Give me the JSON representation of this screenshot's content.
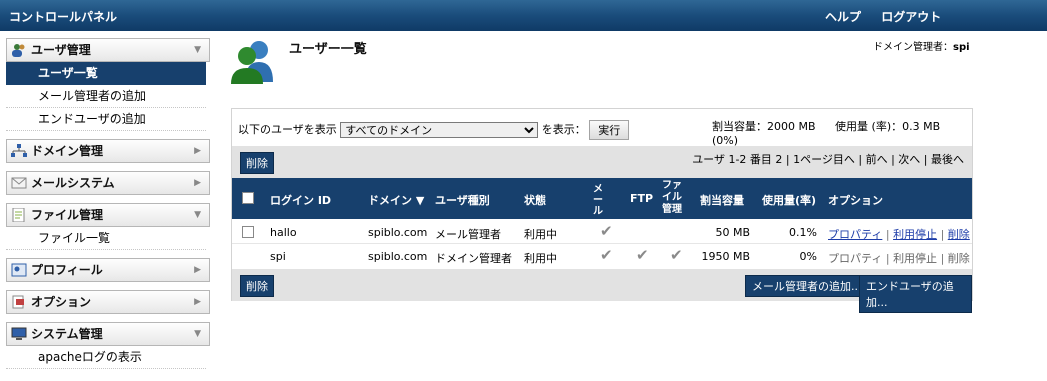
{
  "topbar": {
    "title": "コントロールパネル",
    "help": "ヘルプ",
    "logout": "ログアウト"
  },
  "sidebar": {
    "sections": [
      {
        "label": "ユーザ管理",
        "icon": "users-icon",
        "items": [
          "ユーザ一覧",
          "メール管理者の追加",
          "エンドユーザの追加"
        ]
      },
      {
        "label": "ドメイン管理",
        "icon": "network-icon",
        "items": []
      },
      {
        "label": "メールシステム",
        "icon": "envelope-icon",
        "items": []
      },
      {
        "label": "ファイル管理",
        "icon": "document-icon",
        "items": [
          "ファイル一覧"
        ]
      },
      {
        "label": "プロフィール",
        "icon": "profile-icon",
        "items": []
      },
      {
        "label": "オプション",
        "icon": "options-icon",
        "items": []
      },
      {
        "label": "システム管理",
        "icon": "computer-icon",
        "items": [
          "apacheログの表示"
        ]
      }
    ]
  },
  "page": {
    "title": "ユーザー一覧",
    "domain_admin_label": "ドメイン管理者：",
    "domain_admin": "spi"
  },
  "filter": {
    "label": "以下のユーザを表示",
    "selected": "すべてのドメイン",
    "suffix": "を表示：",
    "run": "実行"
  },
  "quota": {
    "label": "割当容量：2000 MB",
    "usage": "使用量 (率)：0.3 MB (0%)"
  },
  "pager": "ユーザ 1-2 番目 2 | 1ページ目へ | 前へ | 次へ | 最後へ",
  "delete_label": "削除",
  "table": {
    "headers": {
      "login": "ログイン ID",
      "domain": "ドメイン",
      "type": "ユーザ種別",
      "status": "状態",
      "mail": "メール",
      "ftp": "FTP",
      "file": "ファイル管理",
      "quota": "割当容量",
      "usage": "使用量(率)",
      "options": "オプション"
    },
    "rows": [
      {
        "login": "hallo",
        "domain": "spiblo.com",
        "type": "メール管理者",
        "status": "利用中",
        "mail": "✔",
        "ftp": "",
        "file": "",
        "quota": "50  MB",
        "usage": "0.1%",
        "opt1": "プロパティ",
        "opt2": "利用停止",
        "opt3": "削除"
      },
      {
        "login": "spi",
        "domain": "spiblo.com",
        "type": "ドメイン管理者",
        "status": "利用中",
        "mail": "✔",
        "ftp": "✔",
        "file": "✔",
        "quota": "1950  MB",
        "usage": "0%",
        "opt1": "プロパティ",
        "opt2": "利用停止",
        "opt3": "削除"
      }
    ]
  },
  "buttons": {
    "add_mail_admin": "メール管理者の追加...",
    "add_end_user": "エンドユーザの追加..."
  }
}
